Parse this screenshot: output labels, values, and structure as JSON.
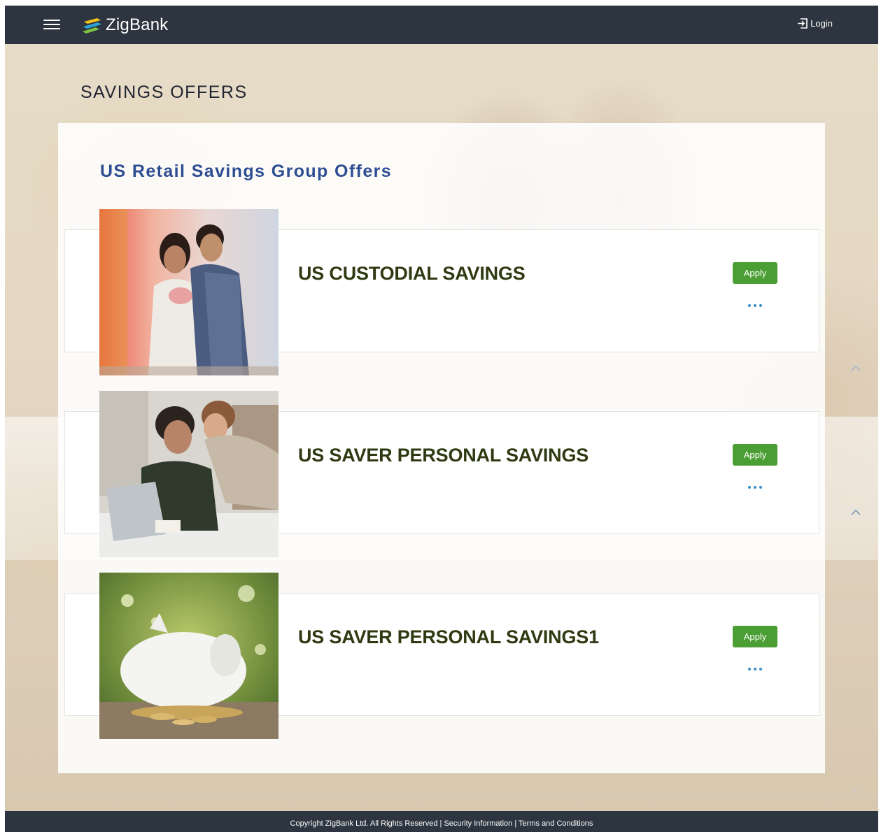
{
  "header": {
    "brand": "ZigBank",
    "login_label": "Login",
    "icons": {
      "menu": "hamburger-icon",
      "login": "login-icon"
    }
  },
  "page": {
    "title": "SAVINGS OFFERS"
  },
  "offers_group": {
    "title": "US Retail Savings Group Offers",
    "offers": [
      {
        "name": "US CUSTODIAL SAVINGS",
        "apply_label": "Apply",
        "image": "couple-with-piggy-bank"
      },
      {
        "name": "US SAVER PERSONAL SAVINGS",
        "apply_label": "Apply",
        "image": "couple-at-laptop"
      },
      {
        "name": "US SAVER PERSONAL SAVINGS1",
        "apply_label": "Apply",
        "image": "white-piggy-bank-coins"
      }
    ]
  },
  "footer": {
    "text": "Copyright ZigBank Ltd. All Rights Reserved | Security Information | Terms and Conditions"
  },
  "colors": {
    "topbar": "#2d3540",
    "group_title": "#2e4e93",
    "offer_name": "#2f3a12",
    "apply_button": "#4a9e33",
    "more_dots": "#3a8ec7"
  }
}
